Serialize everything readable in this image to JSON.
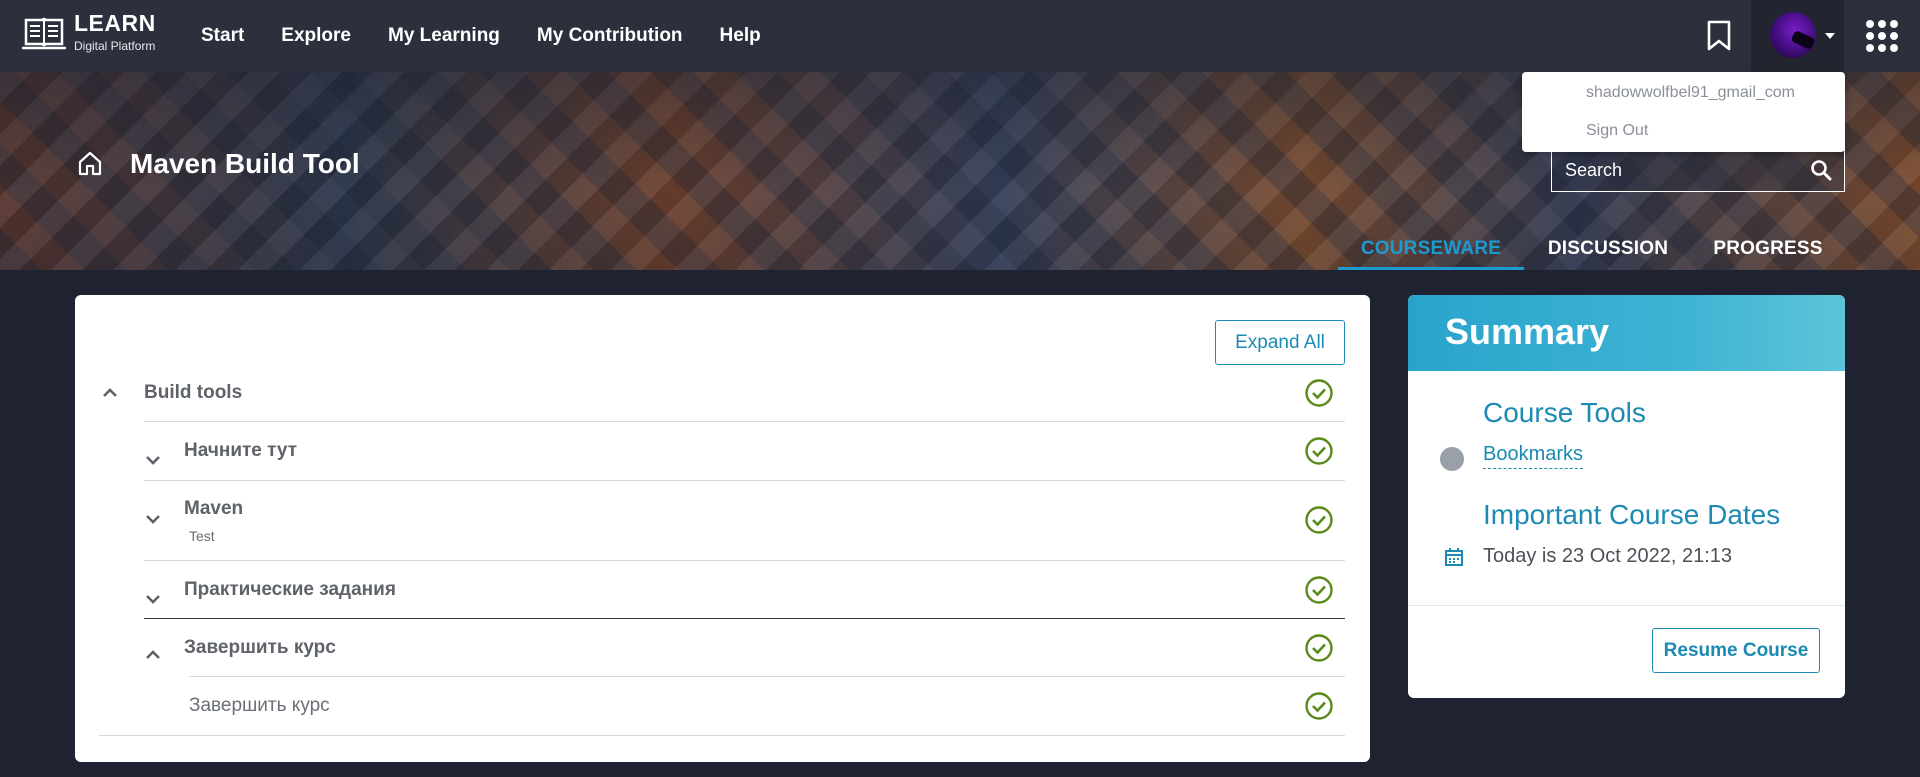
{
  "brand": {
    "title": "LEARN",
    "subtitle": "Digital Platform",
    "logo_icon": "book-icon"
  },
  "nav": {
    "items": [
      {
        "label": "Start"
      },
      {
        "label": "Explore"
      },
      {
        "label": "My Learning"
      },
      {
        "label": "My Contribution"
      },
      {
        "label": "Help"
      }
    ]
  },
  "header_icons": {
    "bookmark": "bookmark-icon",
    "apps": "apps-grid-icon"
  },
  "user_menu": {
    "username": "shadowwolfbel91_gmail_com",
    "sign_out": "Sign Out"
  },
  "course": {
    "title": "Maven Build Tool",
    "search_placeholder": "Search",
    "tabs": [
      {
        "label": "COURSEWARE",
        "active": true
      },
      {
        "label": "DISCUSSION",
        "active": false
      },
      {
        "label": "PROGRESS",
        "active": false
      }
    ]
  },
  "outline": {
    "expand_all": "Expand All",
    "sections": [
      {
        "title": "Build tools",
        "expanded": true,
        "complete": true
      },
      {
        "title": "Начните тут",
        "expanded": false,
        "complete": true
      },
      {
        "title": "Maven",
        "subtitle": "Test",
        "expanded": false,
        "complete": true
      },
      {
        "title": "Практические задания",
        "expanded": false,
        "complete": true
      },
      {
        "title": "Завершить курс",
        "expanded": true,
        "complete": true
      },
      {
        "title": "Завершить курс",
        "complete": true
      }
    ]
  },
  "summary": {
    "title": "Summary",
    "course_tools": "Course Tools",
    "bookmarks": "Bookmarks",
    "important_dates": "Important Course Dates",
    "today": "Today is 23 Oct 2022, 21:13",
    "resume": "Resume Course"
  },
  "colors": {
    "accent": "#1d8ab3",
    "tab_active": "#1d9bd1",
    "check_green": "#5a8a1a",
    "nav_bg": "#2c303d",
    "page_bg": "#1f2331"
  }
}
